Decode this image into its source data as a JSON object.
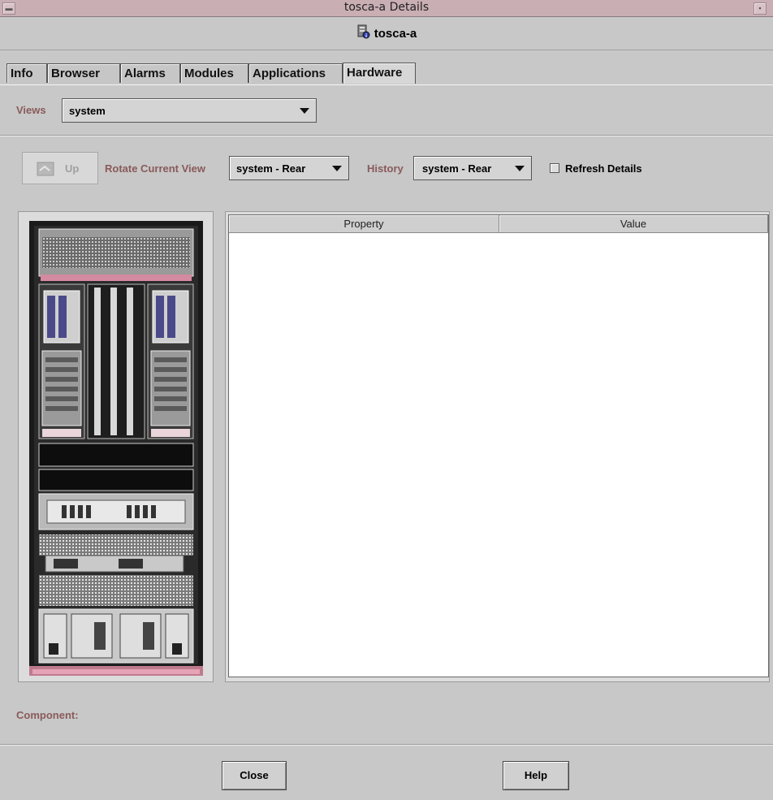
{
  "window": {
    "title": "tosca-a Details"
  },
  "header": {
    "host_name": "tosca-a",
    "host_icon": "server-icon"
  },
  "tabs": [
    {
      "label": "Info",
      "active": false
    },
    {
      "label": "Browser",
      "active": false
    },
    {
      "label": "Alarms",
      "active": false
    },
    {
      "label": "Modules",
      "active": false
    },
    {
      "label": "Applications",
      "active": false
    },
    {
      "label": "Hardware",
      "active": true
    }
  ],
  "views": {
    "label": "Views",
    "selected": "system"
  },
  "toolbar": {
    "up_label": "Up",
    "rotate_label": "Rotate Current View",
    "rotate_selected": "system - Rear",
    "history_label": "History",
    "history_selected": "system - Rear",
    "refresh_label": "Refresh Details",
    "refresh_checked": false
  },
  "table": {
    "columns": [
      "Property",
      "Value"
    ],
    "rows": []
  },
  "component": {
    "label": "Component:"
  },
  "footer": {
    "close_label": "Close",
    "help_label": "Help"
  },
  "colors": {
    "title_bar": "#c9aeb4",
    "label_text": "#8a5a5a",
    "background": "#c8c8c8",
    "rack_accent": "#d48aa0"
  }
}
